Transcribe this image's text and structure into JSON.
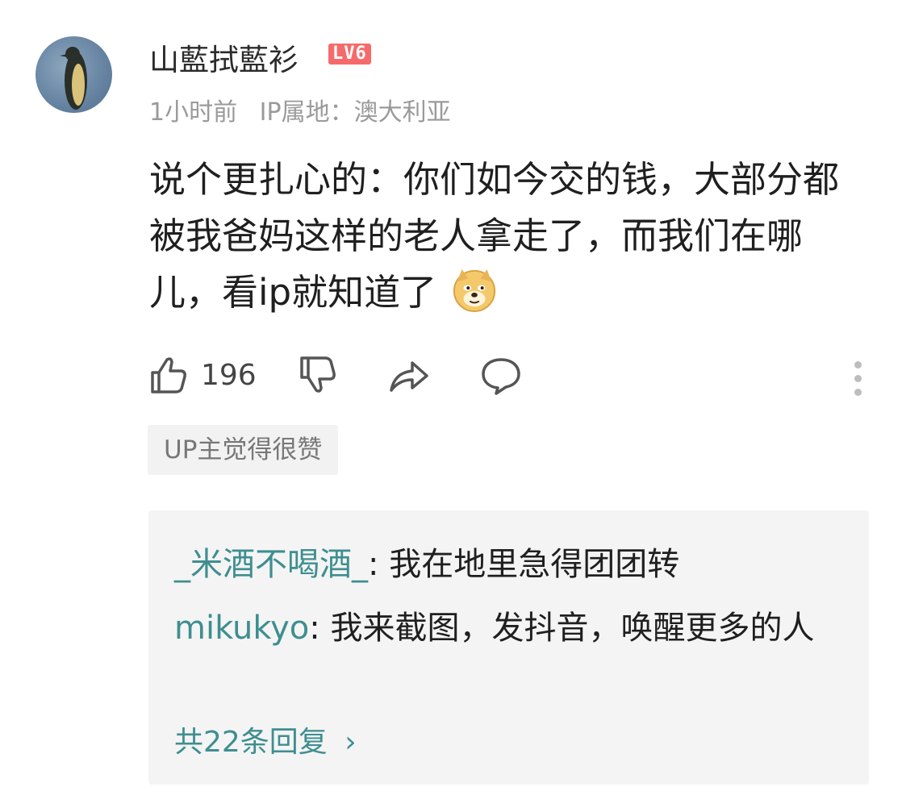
{
  "comment": {
    "username": "山藍拭藍衫",
    "level": "LV6",
    "time": "1小时前",
    "ip_location": "IP属地：澳大利亚",
    "text": "说个更扎心的：你们如今交的钱，大部分都被我爸妈这样的老人拿走了，而我们在哪儿，看ip就知道了",
    "emoji": "doge-emoji",
    "avatar": "penguin-avatar"
  },
  "actions": {
    "like_icon": "thumb-up-icon",
    "like_count": "196",
    "dislike_icon": "thumb-down-icon",
    "share_icon": "share-icon",
    "reply_icon": "comment-bubble-icon",
    "more_icon": "more-vertical-icon"
  },
  "up_tag": "UP主觉得很赞",
  "replies": [
    {
      "user": "_米酒不喝酒_",
      "text": ": 我在地里急得团团转"
    },
    {
      "user": "mikukyo",
      "text": ": 我来截图，发抖音，唤醒更多的人"
    }
  ],
  "replies_total": "共22条回复",
  "colors": {
    "accent": "#3e8e90",
    "level_badge": "#f56b6b",
    "meta_gray": "#9a9a9a",
    "reply_bg": "#f4f4f4"
  }
}
